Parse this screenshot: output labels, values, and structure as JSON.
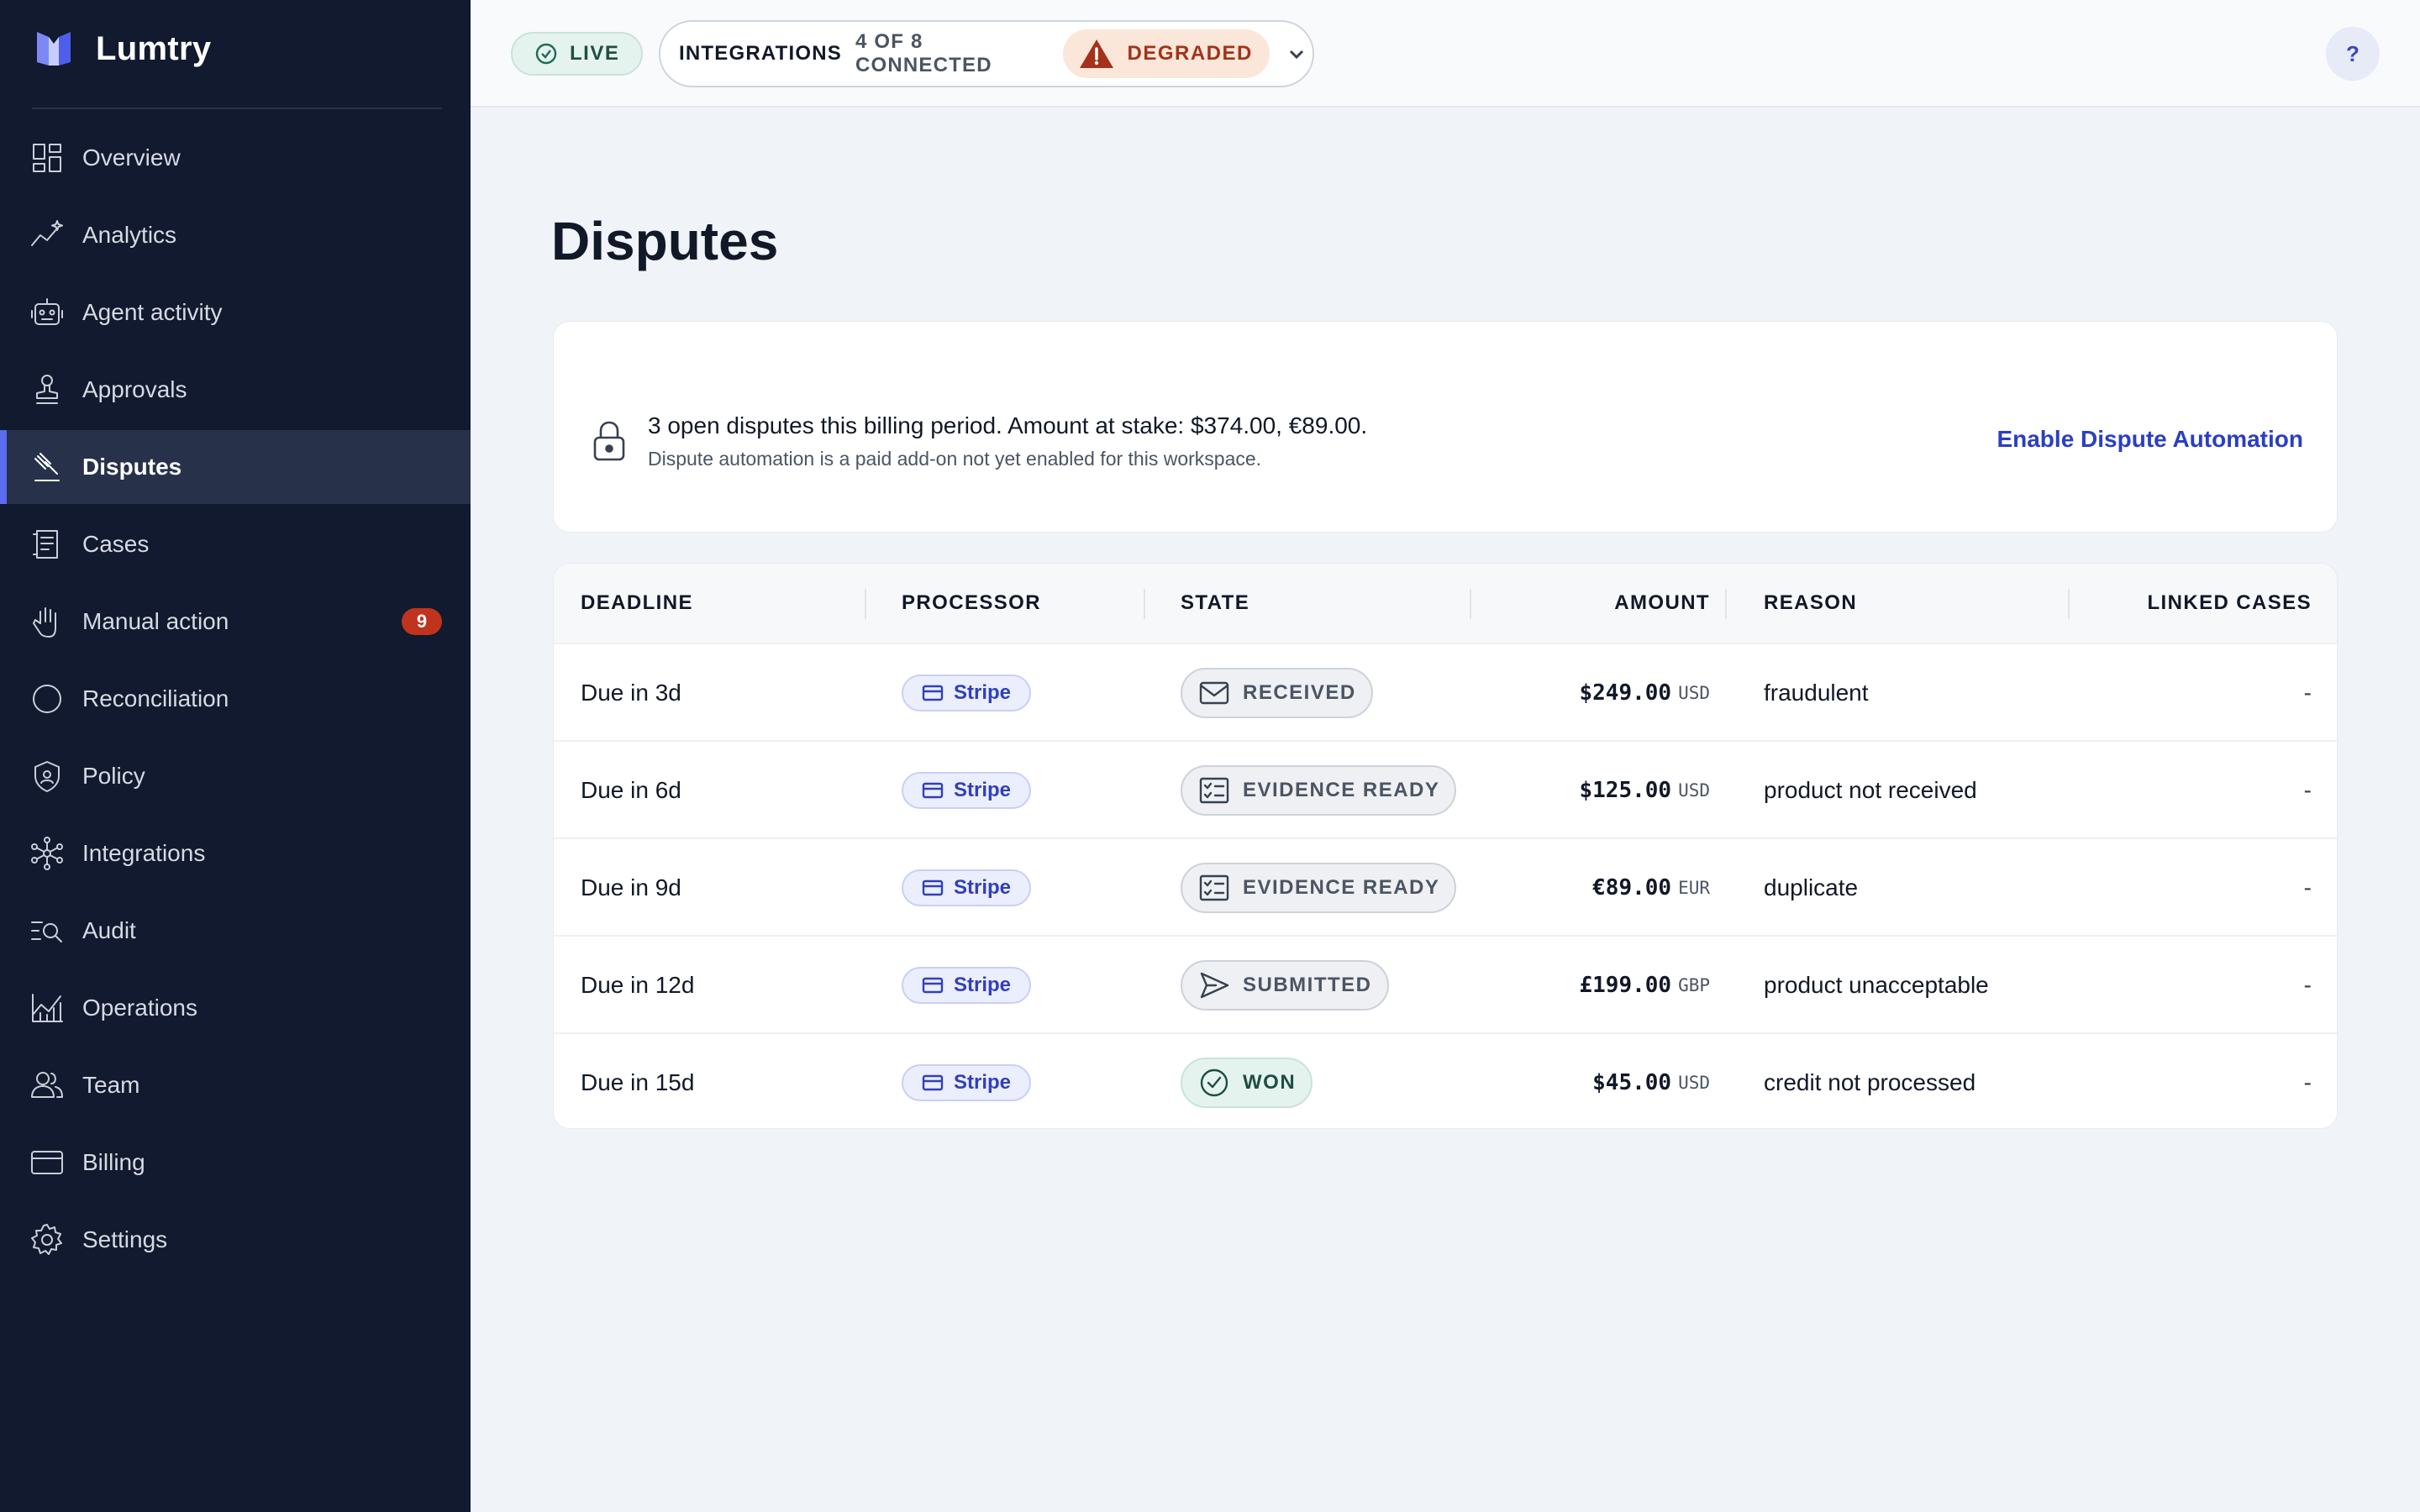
{
  "app": {
    "name": "Lumtry"
  },
  "sidebar": {
    "items": [
      {
        "label": "Overview",
        "icon": "dashboard-icon"
      },
      {
        "label": "Analytics",
        "icon": "analytics-icon"
      },
      {
        "label": "Agent activity",
        "icon": "robot-icon"
      },
      {
        "label": "Approvals",
        "icon": "stamp-icon"
      },
      {
        "label": "Disputes",
        "icon": "gavel-icon",
        "active": true
      },
      {
        "label": "Cases",
        "icon": "receipt-icon"
      },
      {
        "label": "Manual action",
        "icon": "hand-icon",
        "badge": "9"
      },
      {
        "label": "Reconciliation",
        "icon": "circle-icon"
      },
      {
        "label": "Policy",
        "icon": "shield-icon"
      },
      {
        "label": "Integrations",
        "icon": "network-icon"
      },
      {
        "label": "Audit",
        "icon": "search-list-icon"
      },
      {
        "label": "Operations",
        "icon": "chart-icon"
      },
      {
        "label": "Team",
        "icon": "team-icon"
      },
      {
        "label": "Billing",
        "icon": "card-icon"
      },
      {
        "label": "Settings",
        "icon": "gear-icon"
      }
    ]
  },
  "topbar": {
    "live": "LIVE",
    "integrations_label": "INTEGRATIONS",
    "integrations_count": "4 OF 8 CONNECTED",
    "status": "DEGRADED",
    "help": "?"
  },
  "page": {
    "title": "Disputes"
  },
  "notice": {
    "main": "3 open disputes this billing period. Amount at stake: $374.00, €89.00.",
    "sub": "Dispute automation is a paid add-on not yet enabled for this workspace.",
    "link": "Enable Dispute Automation"
  },
  "table": {
    "headers": {
      "deadline": "DEADLINE",
      "processor": "PROCESSOR",
      "state": "STATE",
      "amount": "AMOUNT",
      "reason": "REASON",
      "linked": "LINKED CASES"
    },
    "rows": [
      {
        "deadline": "Due in 3d",
        "processor": "Stripe",
        "state": "RECEIVED",
        "state_icon": "envelope-icon",
        "amount": "$249.00",
        "currency": "USD",
        "reason": "fraudulent",
        "linked": "-"
      },
      {
        "deadline": "Due in 6d",
        "processor": "Stripe",
        "state": "EVIDENCE READY",
        "state_icon": "checklist-icon",
        "amount": "$125.00",
        "currency": "USD",
        "reason": "product not received",
        "linked": "-"
      },
      {
        "deadline": "Due in 9d",
        "processor": "Stripe",
        "state": "EVIDENCE READY",
        "state_icon": "checklist-icon",
        "amount": "€89.00",
        "currency": "EUR",
        "reason": "duplicate",
        "linked": "-"
      },
      {
        "deadline": "Due in 12d",
        "processor": "Stripe",
        "state": "SUBMITTED",
        "state_icon": "send-icon",
        "amount": "£199.00",
        "currency": "GBP",
        "reason": "product unacceptable",
        "linked": "-"
      },
      {
        "deadline": "Due in 15d",
        "processor": "Stripe",
        "state": "WON",
        "state_icon": "check-circle-icon",
        "amount": "$45.00",
        "currency": "USD",
        "reason": "credit not processed",
        "linked": "-"
      }
    ]
  },
  "colors": {
    "sidebar_bg": "#111a2e",
    "accent": "#5b6cf0",
    "link": "#2b3ec4",
    "degraded": "#a4321a",
    "live": "#1f4e42",
    "badge": "#c0331d"
  }
}
